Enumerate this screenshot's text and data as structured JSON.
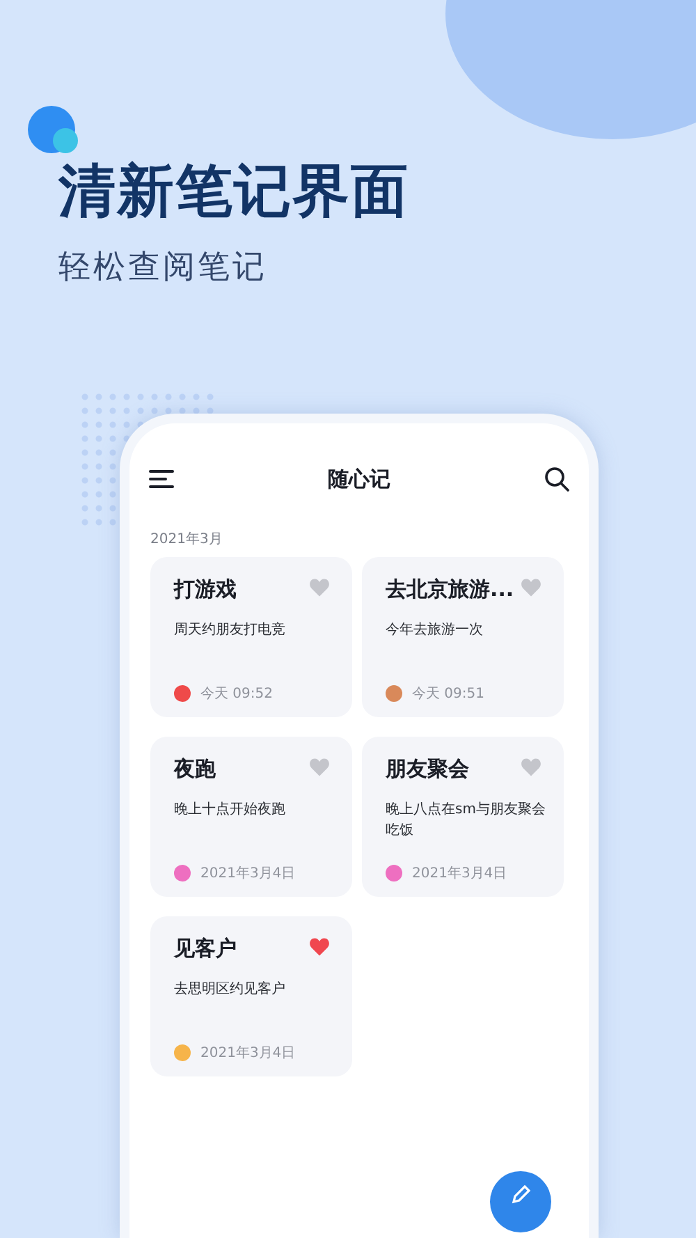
{
  "hero": {
    "title": "清新笔记界面",
    "subtitle": "轻松查阅笔记"
  },
  "app": {
    "title": "随心记",
    "section": "2021年3月",
    "notes": [
      {
        "title": "打游戏",
        "body": "周天约朋友打电竞",
        "date": "今天 09:52",
        "color": "#ef4a4a",
        "favorite": false
      },
      {
        "title": "去北京旅游...",
        "body": "今年去旅游一次",
        "date": "今天 09:51",
        "color": "#d9895a",
        "favorite": false
      },
      {
        "title": "夜跑",
        "body": "晚上十点开始夜跑",
        "date": "2021年3月4日",
        "color": "#ee6fc0",
        "favorite": false
      },
      {
        "title": "朋友聚会",
        "body": "晚上八点在sm与朋友聚会吃饭",
        "date": "2021年3月4日",
        "color": "#ee6fc0",
        "favorite": false
      },
      {
        "title": "见客户",
        "body": "去思明区约见客户",
        "date": "2021年3月4日",
        "color": "#f6b44a",
        "favorite": true
      }
    ]
  }
}
